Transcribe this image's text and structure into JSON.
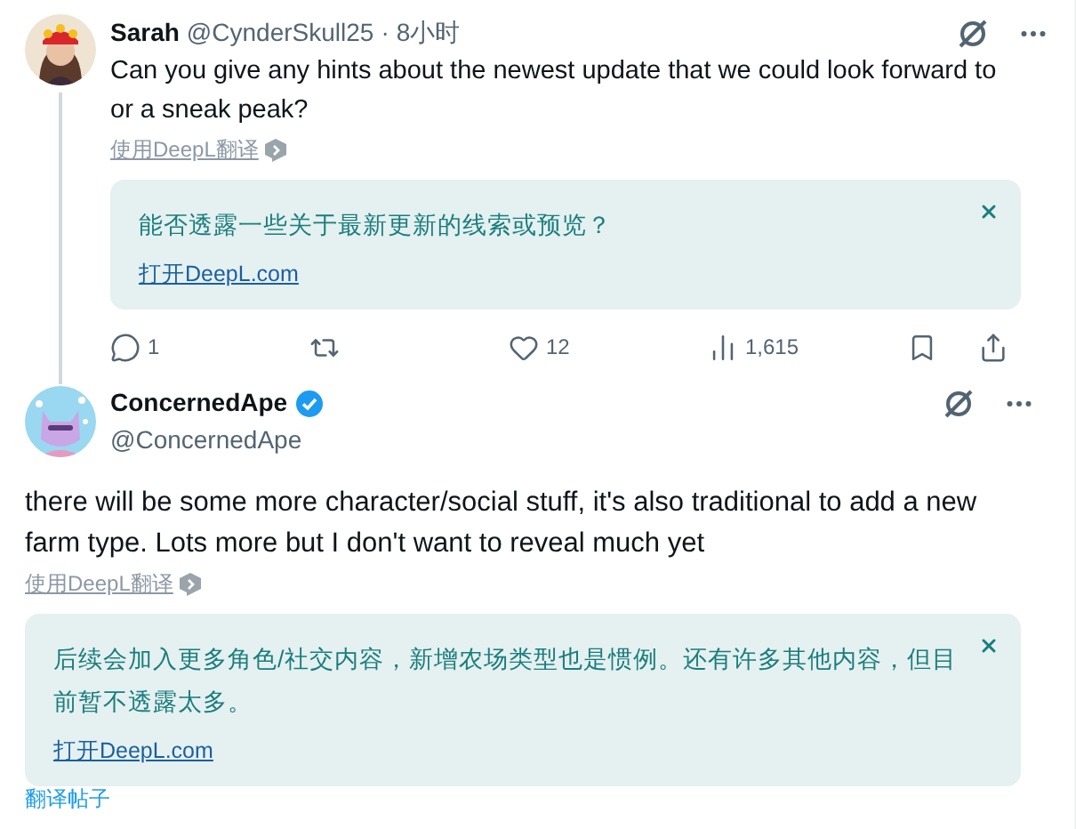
{
  "tweets": [
    {
      "kind": "reply",
      "name": "Sarah",
      "verified": false,
      "handle": "@CynderSkull25",
      "separator": "·",
      "time": "8小时",
      "text": "Can you give any hints about the newest update that we could look forward to or a sneak peak?",
      "translate_link": "使用DeepL翻译",
      "translation": {
        "text": "能否透露一些关于最新更新的线索或预览？",
        "link": "打开DeepL.com"
      },
      "actions": [
        {
          "kind": "reply",
          "count": "1"
        },
        {
          "kind": "retweet"
        },
        {
          "kind": "like",
          "count": "12"
        },
        {
          "kind": "views",
          "count": "1,615"
        },
        {
          "kind": "bookmark"
        },
        {
          "kind": "share"
        }
      ]
    },
    {
      "kind": "main",
      "name": "ConcernedApe",
      "verified": true,
      "handle": "@ConcernedApe",
      "text": "there will be some more character/social stuff, it's also traditional to add a new farm type. Lots more but I don't want to reveal much yet",
      "translate_link": "使用DeepL翻译",
      "translation": {
        "text": "后续会加入更多角色/社交内容，新增农场类型也是惯例。还有许多其他内容，但目前暂不透露太多。",
        "link": "打开DeepL.com"
      },
      "footer_link": "翻译帖子"
    }
  ]
}
